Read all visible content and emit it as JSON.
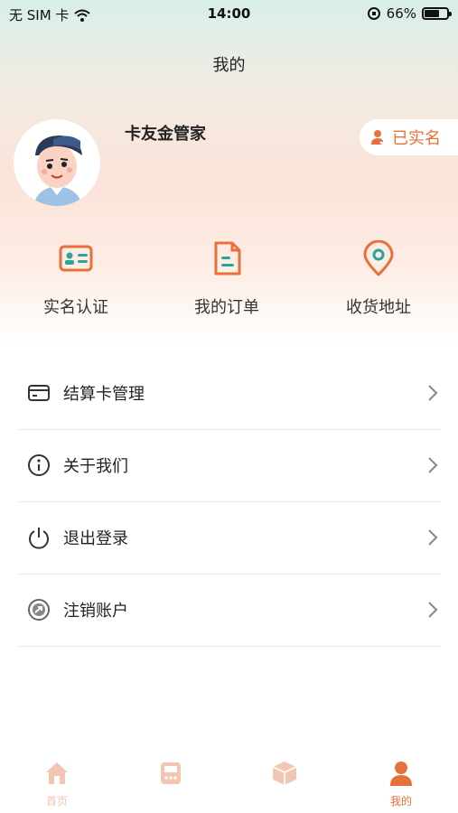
{
  "status_bar": {
    "carrier": "无 SIM 卡",
    "time": "14:00",
    "battery_percent": "66%",
    "battery_level": 0.66
  },
  "nav": {
    "title": "我的"
  },
  "profile": {
    "name": "卡友金管家",
    "verified_label": "已实名"
  },
  "quick_actions": [
    {
      "label": "实名认证",
      "icon": "id-card-icon"
    },
    {
      "label": "我的订单",
      "icon": "document-icon"
    },
    {
      "label": "收货地址",
      "icon": "location-pin-icon"
    }
  ],
  "menu": [
    {
      "label": "结算卡管理",
      "icon": "card-icon"
    },
    {
      "label": "关于我们",
      "icon": "info-icon"
    },
    {
      "label": "退出登录",
      "icon": "power-icon"
    },
    {
      "label": "注销账户",
      "icon": "cancel-account-icon"
    }
  ],
  "tabbar": [
    {
      "label": "首页",
      "icon": "home-icon",
      "active": false
    },
    {
      "label": "",
      "icon": "pos-icon",
      "active": false
    },
    {
      "label": "",
      "icon": "box-icon",
      "active": false
    },
    {
      "label": "我的",
      "icon": "person-icon",
      "active": true
    }
  ],
  "colors": {
    "accent": "#e8703a",
    "teal": "#2aa59a",
    "tab_inactive": "#f3c6b3"
  }
}
